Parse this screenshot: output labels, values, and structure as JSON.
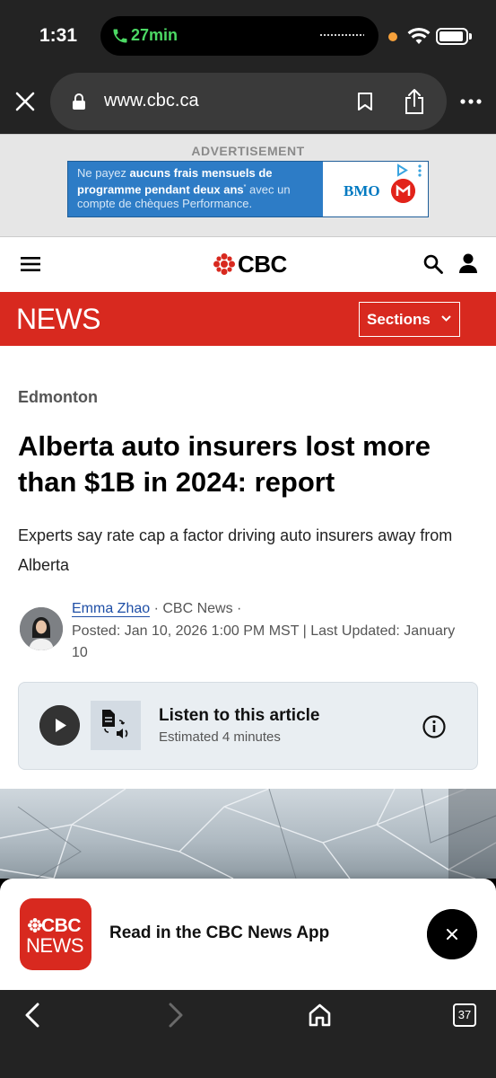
{
  "status_bar": {
    "time": "1:31",
    "call_duration": "27min"
  },
  "browser": {
    "url": "www.cbc.ca",
    "tab_count": "37"
  },
  "ad": {
    "label": "ADVERTISEMENT",
    "text_bold_1": "Ne payez",
    "text_bold_2": "aucuns frais mensuels de programme pendant deux ans",
    "text_light_1": "avec",
    "text_light_2": "un compte de chèques Performance.",
    "brand": "BMO"
  },
  "site": {
    "logo": "CBC",
    "section_bar_title": "NEWS",
    "sections_button": "Sections"
  },
  "article": {
    "kicker": "Edmonton",
    "headline": "Alberta auto insurers lost more than $1B in 2024: report",
    "deck": "Experts say rate cap a factor driving auto insurers away from Alberta",
    "author": "Emma Zhao",
    "outlet": " · CBC News ·",
    "posted": "Posted: Jan 10, 2026 1:00 PM MST | Last Updated: January 10"
  },
  "listen": {
    "title": "Listen to this article",
    "subtitle": "Estimated 4 minutes"
  },
  "app_banner": {
    "icon_line_1": "CBC",
    "icon_line_2": "NEWS",
    "text": "Read in the CBC News App"
  },
  "colors": {
    "cbc_red": "#d8291f",
    "link_blue": "#1f4fa6",
    "call_green": "#4cd964"
  }
}
